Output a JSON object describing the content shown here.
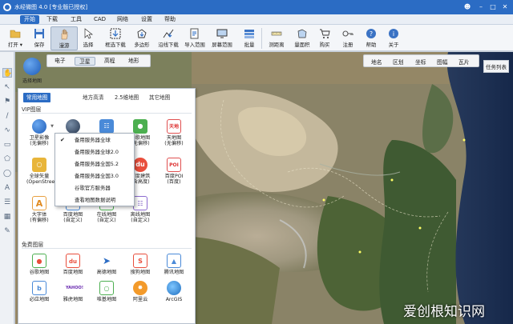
{
  "titlebar": {
    "title": "水经微图 4.0 [专业版已授权]",
    "user_icon": "user-icon",
    "minimize": "minimize-icon",
    "maximize": "maximize-icon",
    "close": "close-icon"
  },
  "menu": [
    "开始",
    "下载",
    "工具",
    "CAD",
    "网络",
    "设置",
    "帮助"
  ],
  "toolbar": [
    {
      "label": "打开 ▾",
      "icon": "folder-icon"
    },
    {
      "label": "保存",
      "icon": "save-icon"
    },
    {
      "label": "漫游",
      "icon": "hand-icon"
    },
    {
      "label": "选择",
      "icon": "pointer-icon"
    },
    {
      "label": "框选下载",
      "icon": "box-download-icon"
    },
    {
      "label": "多边形",
      "icon": "polygon-icon"
    },
    {
      "label": "沿线下载",
      "icon": "line-download-icon"
    },
    {
      "label": "导入范围",
      "icon": "import-range-icon"
    },
    {
      "label": "屏幕范围",
      "icon": "screen-range-icon"
    },
    {
      "label": "批量",
      "icon": "batch-icon"
    },
    {
      "label": "测距离",
      "icon": "ruler-icon"
    },
    {
      "label": "量面积",
      "icon": "area-icon"
    },
    {
      "label": "购买",
      "icon": "cart-icon"
    },
    {
      "label": "注册",
      "icon": "key-icon"
    },
    {
      "label": "帮助",
      "icon": "help-icon"
    },
    {
      "label": "关于",
      "icon": "info-icon"
    }
  ],
  "map_tabs": [
    "电子",
    "卫星",
    "高程",
    "地形"
  ],
  "map_tab_active": "卫星",
  "right_tabs": [
    "地名",
    "区划",
    "坐标",
    "图幅",
    "瓦片"
  ],
  "task_list": "任务列表",
  "map_source_label": "选择地图",
  "panel": {
    "tabs": [
      "常用地图",
      "地方高清",
      "2.5维地图",
      "其它地图"
    ],
    "active_tab": "常用地图",
    "vip_title": "VIP图层",
    "vip_items": [
      {
        "name": "卫星影像",
        "sub": "(无偏移)",
        "icon": "globe-blue-icon",
        "dropdown": true
      },
      {
        "name": "",
        "sub": "",
        "icon": "globe-dark-icon"
      },
      {
        "name": "",
        "sub": "",
        "icon": "map-blue-icon"
      },
      {
        "name": "谷歌地图",
        "sub": "(无偏移)",
        "icon": "google-maps-icon"
      },
      {
        "name": "天地图",
        "sub": "(无偏移)",
        "icon": "tianditu-icon"
      },
      {
        "name": "全球矢量",
        "sub": "(OpenStreet)",
        "icon": "globe-vector-icon"
      },
      {
        "name": "",
        "sub": "",
        "icon": "blank-icon"
      },
      {
        "name": "",
        "sub": "",
        "icon": "blank-icon"
      },
      {
        "name": "百度建筑",
        "sub": "(含高度)",
        "icon": "baidu-icon"
      },
      {
        "name": "百度POI",
        "sub": "(百度)",
        "icon": "poi-icon"
      },
      {
        "name": "大字体",
        "sub": "(有偏移)",
        "icon": "font-a-icon"
      },
      {
        "name": "百度地图",
        "sub": "(自定义)",
        "icon": "baidu-custom-icon"
      },
      {
        "name": "在线地图",
        "sub": "(自定义)",
        "icon": "online-map-icon"
      },
      {
        "name": "离线地图",
        "sub": "(自定义)",
        "icon": "offline-map-icon"
      }
    ],
    "free_title": "免费图层",
    "free_items": [
      {
        "name": "谷歌地图",
        "icon": "google-free-icon"
      },
      {
        "name": "百度地图",
        "icon": "baidu-free-icon"
      },
      {
        "name": "高德地图",
        "icon": "amap-icon"
      },
      {
        "name": "搜狗地图",
        "icon": "sogou-icon"
      },
      {
        "name": "腾讯地图",
        "icon": "tencent-icon"
      },
      {
        "name": "必应地图",
        "icon": "bing-icon"
      },
      {
        "name": "雅虎地图",
        "icon": "yahoo-icon"
      },
      {
        "name": "堆基地图",
        "icon": "bubble-icon"
      },
      {
        "name": "阿里云",
        "icon": "aliyun-icon"
      },
      {
        "name": "ArcGIS",
        "icon": "arcgis-icon"
      }
    ]
  },
  "context_menu": {
    "items": [
      "备用服务器全球",
      "备用服务器全球2.0",
      "备用服务器全国5.2",
      "备用服务器全国3.0",
      "谷歌官方服务器",
      "查看地图数据说明"
    ],
    "checked": "备用服务器全球"
  },
  "watermark": "爱创根知识网"
}
